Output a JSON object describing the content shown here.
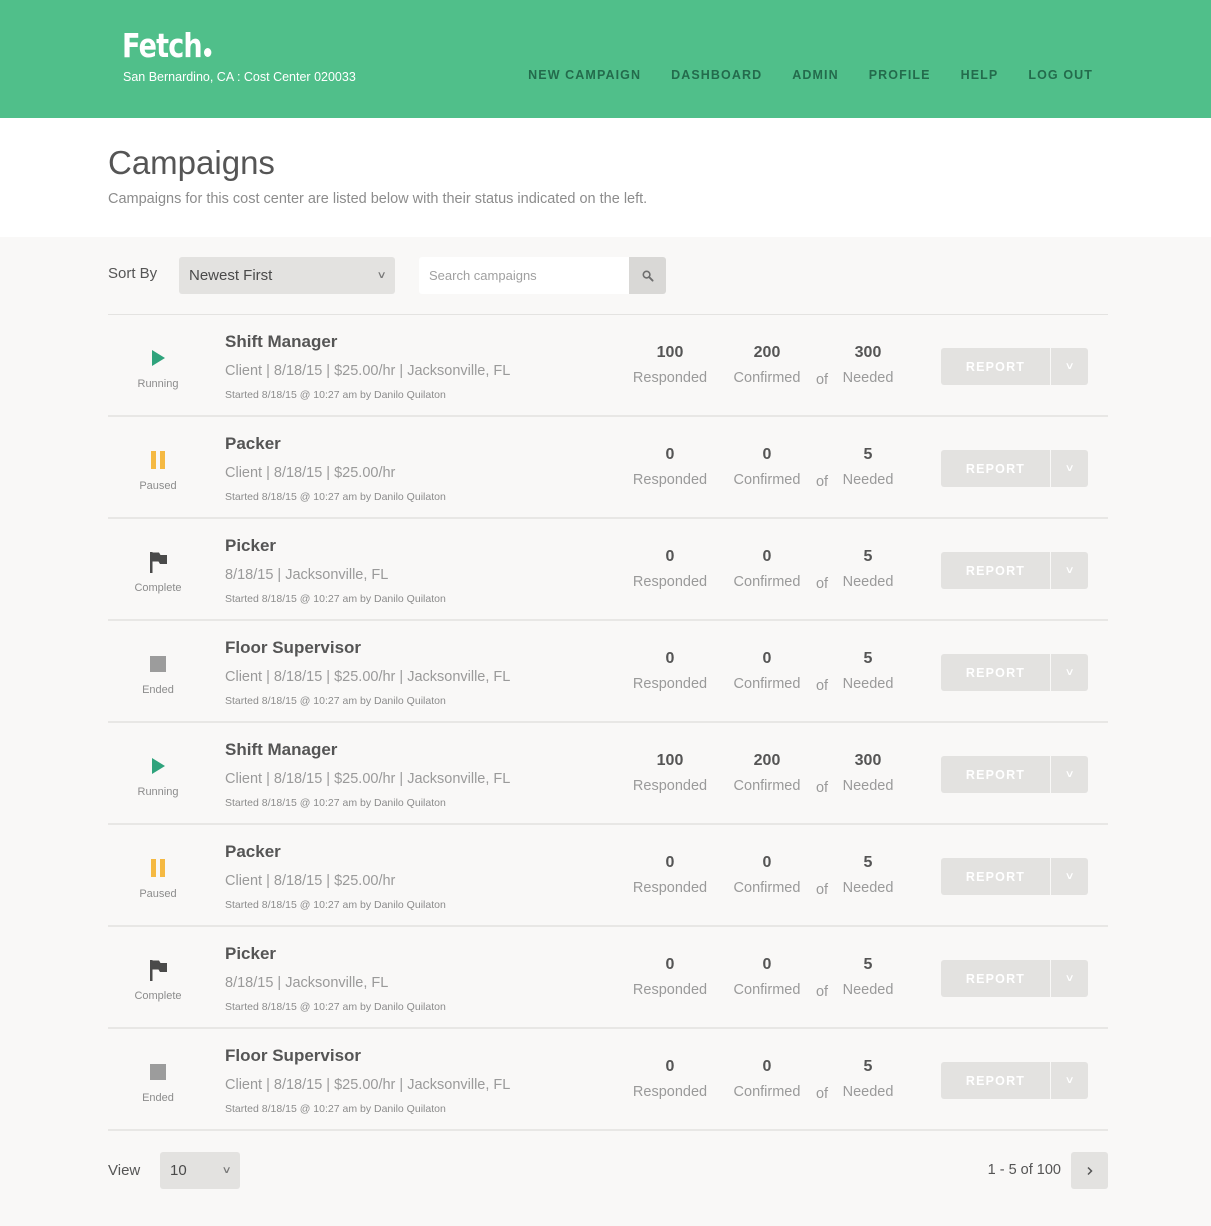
{
  "header": {
    "logo_text": "Fetch",
    "cost_center": "San Bernardino, CA : Cost Center 020033",
    "nav": [
      "NEW CAMPAIGN",
      "DASHBOARD",
      "ADMIN",
      "PROFILE",
      "HELP",
      "LOG OUT"
    ],
    "brand_color": "#50bf8a"
  },
  "intro": {
    "title": "Campaigns",
    "subtitle": "Campaigns for this cost center are listed below with their status indicated on the left."
  },
  "toolbar": {
    "sort_label": "Sort By",
    "sort_value": "Newest First",
    "search_placeholder": "Search campaigns",
    "search_icon": "search-icon"
  },
  "labels": {
    "responded": "Responded",
    "confirmed": "Confirmed",
    "of": "of",
    "needed": "Needed",
    "report": "REPORT"
  },
  "status_styles": {
    "running": {
      "icon": "play-icon",
      "color": "#2fa37c"
    },
    "paused": {
      "icon": "pause-icon",
      "color": "#f5b942"
    },
    "complete": {
      "icon": "flag-icon",
      "color": "#4a4a4a"
    },
    "ended": {
      "icon": "stop-icon",
      "color": "#9c9c9c"
    }
  },
  "campaigns": [
    {
      "status": "running",
      "status_label": "Running",
      "title": "Shift Manager",
      "details": "Client | 8/18/15 | $25.00/hr | Jacksonville, FL",
      "started": "Started 8/18/15 @ 10:27 am by Danilo Quilaton",
      "responded": "100",
      "confirmed": "200",
      "needed": "300"
    },
    {
      "status": "paused",
      "status_label": "Paused",
      "title": "Packer",
      "details": "Client | 8/18/15 | $25.00/hr",
      "started": "Started 8/18/15 @ 10:27 am by Danilo Quilaton",
      "responded": "0",
      "confirmed": "0",
      "needed": "5"
    },
    {
      "status": "complete",
      "status_label": "Complete",
      "title": "Picker",
      "details": "8/18/15 | Jacksonville, FL",
      "started": "Started 8/18/15 @ 10:27 am by Danilo Quilaton",
      "responded": "0",
      "confirmed": "0",
      "needed": "5"
    },
    {
      "status": "ended",
      "status_label": "Ended",
      "title": "Floor Supervisor",
      "details": "Client | 8/18/15 | $25.00/hr | Jacksonville, FL",
      "started": "Started 8/18/15 @ 10:27 am by Danilo Quilaton",
      "responded": "0",
      "confirmed": "0",
      "needed": "5"
    },
    {
      "status": "running",
      "status_label": "Running",
      "title": "Shift Manager",
      "details": "Client | 8/18/15 | $25.00/hr | Jacksonville, FL",
      "started": "Started 8/18/15 @ 10:27 am by Danilo Quilaton",
      "responded": "100",
      "confirmed": "200",
      "needed": "300"
    },
    {
      "status": "paused",
      "status_label": "Paused",
      "title": "Packer",
      "details": "Client | 8/18/15 | $25.00/hr",
      "started": "Started 8/18/15 @ 10:27 am by Danilo Quilaton",
      "responded": "0",
      "confirmed": "0",
      "needed": "5"
    },
    {
      "status": "complete",
      "status_label": "Complete",
      "title": "Picker",
      "details": "8/18/15 | Jacksonville, FL",
      "started": "Started 8/18/15 @ 10:27 am by Danilo Quilaton",
      "responded": "0",
      "confirmed": "0",
      "needed": "5"
    },
    {
      "status": "ended",
      "status_label": "Ended",
      "title": "Floor Supervisor",
      "details": "Client | 8/18/15 | $25.00/hr | Jacksonville, FL",
      "started": "Started 8/18/15 @ 10:27 am by Danilo Quilaton",
      "responded": "0",
      "confirmed": "0",
      "needed": "5"
    }
  ],
  "footer": {
    "view_label": "View",
    "view_value": "10",
    "page_info": "1 - 5 of 100",
    "next_icon": "chevron-right-icon"
  }
}
